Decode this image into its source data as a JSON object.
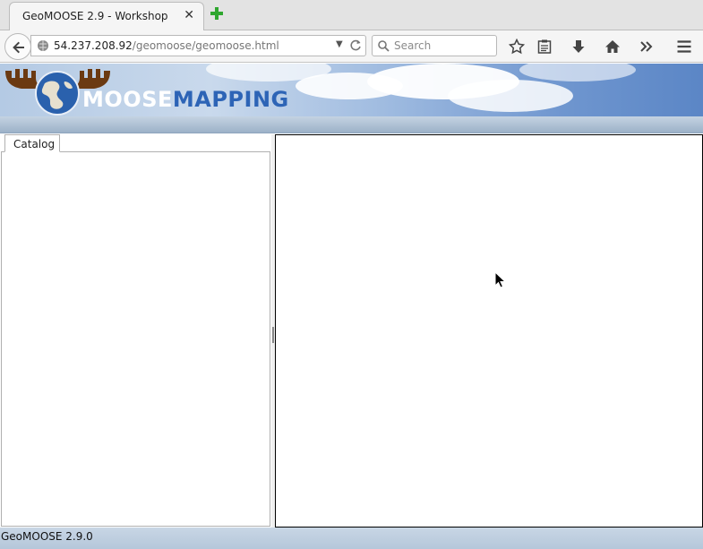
{
  "browser": {
    "tab_title": "GeoMOOSE 2.9 - Workshop",
    "url_host": "54.237.208.92",
    "url_path": "/geomoose/geomoose.html",
    "search_placeholder": "Search"
  },
  "header": {
    "logo_part1": "MOOSE",
    "logo_part2": "MAPPING"
  },
  "left_panel": {
    "tabs": [
      {
        "label": "Catalog"
      }
    ]
  },
  "status": {
    "text": "GeoMOOSE 2.9.0"
  },
  "icons": {
    "tab_close": "close-icon",
    "new_tab": "plus-icon",
    "back": "back-arrow-icon",
    "site_info": "globe-icon",
    "reload": "reload-icon",
    "search": "search-icon",
    "bookmark": "star-icon",
    "reading_list": "clipboard-icon",
    "downloads": "download-icon",
    "home": "home-icon",
    "overflow": "chevron-double-right-icon",
    "menu": "hamburger-icon"
  },
  "colors": {
    "logo_mapping": "#2d64b6",
    "new_tab_plus": "#2fa72f"
  }
}
